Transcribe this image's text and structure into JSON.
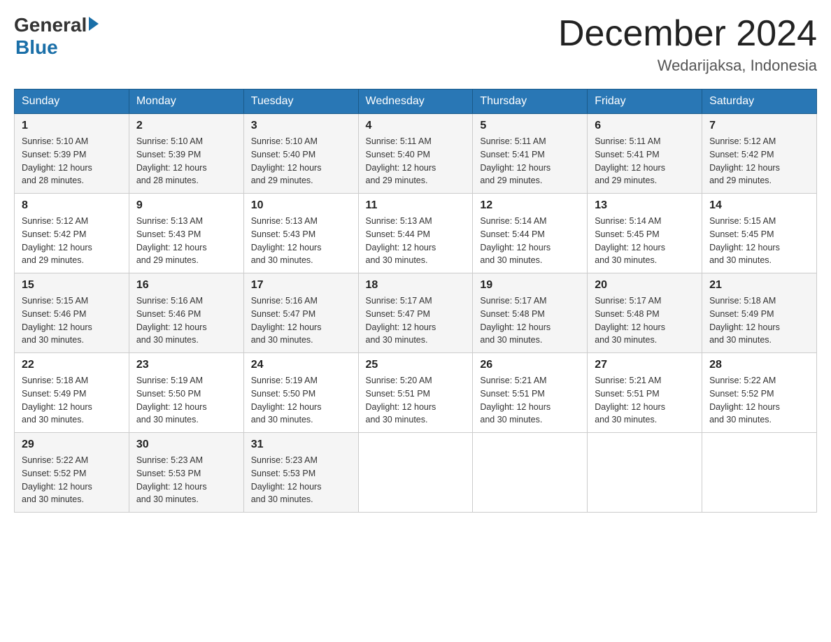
{
  "logo": {
    "general": "General",
    "blue": "Blue"
  },
  "title": "December 2024",
  "location": "Wedarijaksa, Indonesia",
  "days_of_week": [
    "Sunday",
    "Monday",
    "Tuesday",
    "Wednesday",
    "Thursday",
    "Friday",
    "Saturday"
  ],
  "weeks": [
    [
      {
        "day": "1",
        "sunrise": "5:10 AM",
        "sunset": "5:39 PM",
        "daylight": "12 hours and 28 minutes."
      },
      {
        "day": "2",
        "sunrise": "5:10 AM",
        "sunset": "5:39 PM",
        "daylight": "12 hours and 28 minutes."
      },
      {
        "day": "3",
        "sunrise": "5:10 AM",
        "sunset": "5:40 PM",
        "daylight": "12 hours and 29 minutes."
      },
      {
        "day": "4",
        "sunrise": "5:11 AM",
        "sunset": "5:40 PM",
        "daylight": "12 hours and 29 minutes."
      },
      {
        "day": "5",
        "sunrise": "5:11 AM",
        "sunset": "5:41 PM",
        "daylight": "12 hours and 29 minutes."
      },
      {
        "day": "6",
        "sunrise": "5:11 AM",
        "sunset": "5:41 PM",
        "daylight": "12 hours and 29 minutes."
      },
      {
        "day": "7",
        "sunrise": "5:12 AM",
        "sunset": "5:42 PM",
        "daylight": "12 hours and 29 minutes."
      }
    ],
    [
      {
        "day": "8",
        "sunrise": "5:12 AM",
        "sunset": "5:42 PM",
        "daylight": "12 hours and 29 minutes."
      },
      {
        "day": "9",
        "sunrise": "5:13 AM",
        "sunset": "5:43 PM",
        "daylight": "12 hours and 29 minutes."
      },
      {
        "day": "10",
        "sunrise": "5:13 AM",
        "sunset": "5:43 PM",
        "daylight": "12 hours and 30 minutes."
      },
      {
        "day": "11",
        "sunrise": "5:13 AM",
        "sunset": "5:44 PM",
        "daylight": "12 hours and 30 minutes."
      },
      {
        "day": "12",
        "sunrise": "5:14 AM",
        "sunset": "5:44 PM",
        "daylight": "12 hours and 30 minutes."
      },
      {
        "day": "13",
        "sunrise": "5:14 AM",
        "sunset": "5:45 PM",
        "daylight": "12 hours and 30 minutes."
      },
      {
        "day": "14",
        "sunrise": "5:15 AM",
        "sunset": "5:45 PM",
        "daylight": "12 hours and 30 minutes."
      }
    ],
    [
      {
        "day": "15",
        "sunrise": "5:15 AM",
        "sunset": "5:46 PM",
        "daylight": "12 hours and 30 minutes."
      },
      {
        "day": "16",
        "sunrise": "5:16 AM",
        "sunset": "5:46 PM",
        "daylight": "12 hours and 30 minutes."
      },
      {
        "day": "17",
        "sunrise": "5:16 AM",
        "sunset": "5:47 PM",
        "daylight": "12 hours and 30 minutes."
      },
      {
        "day": "18",
        "sunrise": "5:17 AM",
        "sunset": "5:47 PM",
        "daylight": "12 hours and 30 minutes."
      },
      {
        "day": "19",
        "sunrise": "5:17 AM",
        "sunset": "5:48 PM",
        "daylight": "12 hours and 30 minutes."
      },
      {
        "day": "20",
        "sunrise": "5:17 AM",
        "sunset": "5:48 PM",
        "daylight": "12 hours and 30 minutes."
      },
      {
        "day": "21",
        "sunrise": "5:18 AM",
        "sunset": "5:49 PM",
        "daylight": "12 hours and 30 minutes."
      }
    ],
    [
      {
        "day": "22",
        "sunrise": "5:18 AM",
        "sunset": "5:49 PM",
        "daylight": "12 hours and 30 minutes."
      },
      {
        "day": "23",
        "sunrise": "5:19 AM",
        "sunset": "5:50 PM",
        "daylight": "12 hours and 30 minutes."
      },
      {
        "day": "24",
        "sunrise": "5:19 AM",
        "sunset": "5:50 PM",
        "daylight": "12 hours and 30 minutes."
      },
      {
        "day": "25",
        "sunrise": "5:20 AM",
        "sunset": "5:51 PM",
        "daylight": "12 hours and 30 minutes."
      },
      {
        "day": "26",
        "sunrise": "5:21 AM",
        "sunset": "5:51 PM",
        "daylight": "12 hours and 30 minutes."
      },
      {
        "day": "27",
        "sunrise": "5:21 AM",
        "sunset": "5:51 PM",
        "daylight": "12 hours and 30 minutes."
      },
      {
        "day": "28",
        "sunrise": "5:22 AM",
        "sunset": "5:52 PM",
        "daylight": "12 hours and 30 minutes."
      }
    ],
    [
      {
        "day": "29",
        "sunrise": "5:22 AM",
        "sunset": "5:52 PM",
        "daylight": "12 hours and 30 minutes."
      },
      {
        "day": "30",
        "sunrise": "5:23 AM",
        "sunset": "5:53 PM",
        "daylight": "12 hours and 30 minutes."
      },
      {
        "day": "31",
        "sunrise": "5:23 AM",
        "sunset": "5:53 PM",
        "daylight": "12 hours and 30 minutes."
      },
      null,
      null,
      null,
      null
    ]
  ],
  "labels": {
    "sunrise": "Sunrise:",
    "sunset": "Sunset:",
    "daylight": "Daylight:"
  }
}
